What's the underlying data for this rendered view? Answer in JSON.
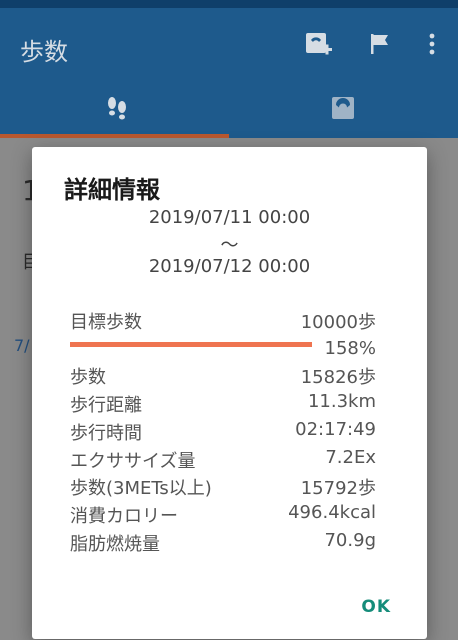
{
  "app": {
    "title": "歩数",
    "tab_selected_index": 0
  },
  "icons": {
    "scale_add": "scale-add-icon",
    "flag": "flag-icon",
    "overflow": "more-vert-icon",
    "steps_tab": "footprints-icon",
    "weight_tab": "scale-icon"
  },
  "background": {
    "partial_text_1": "目",
    "partial_text_2": "7/"
  },
  "dialog": {
    "title": "詳細情報",
    "date_from": "2019/07/11 00:00",
    "date_sep": "〜",
    "date_to": "2019/07/12 00:00",
    "goal_label": "目標歩数",
    "goal_value": "10000歩",
    "goal_percent": "158%",
    "goal_ratio": 1.0,
    "rows": [
      {
        "label": "歩数",
        "value": "15826歩"
      },
      {
        "label": "歩行距離",
        "value": "11.3km"
      },
      {
        "label": "歩行時間",
        "value": "02:17:49"
      },
      {
        "label": "エクササイズ量",
        "value": "7.2Ex"
      },
      {
        "label": "歩数(3METs以上)",
        "value": "15792歩"
      },
      {
        "label": "消費カロリー",
        "value": "496.4kcal"
      },
      {
        "label": "脂肪燃焼量",
        "value": "70.9g"
      }
    ],
    "ok_label": "OK"
  },
  "colors": {
    "appbar": "#1e5a8c",
    "progress": "#ef7450",
    "accent": "#158c7a"
  }
}
